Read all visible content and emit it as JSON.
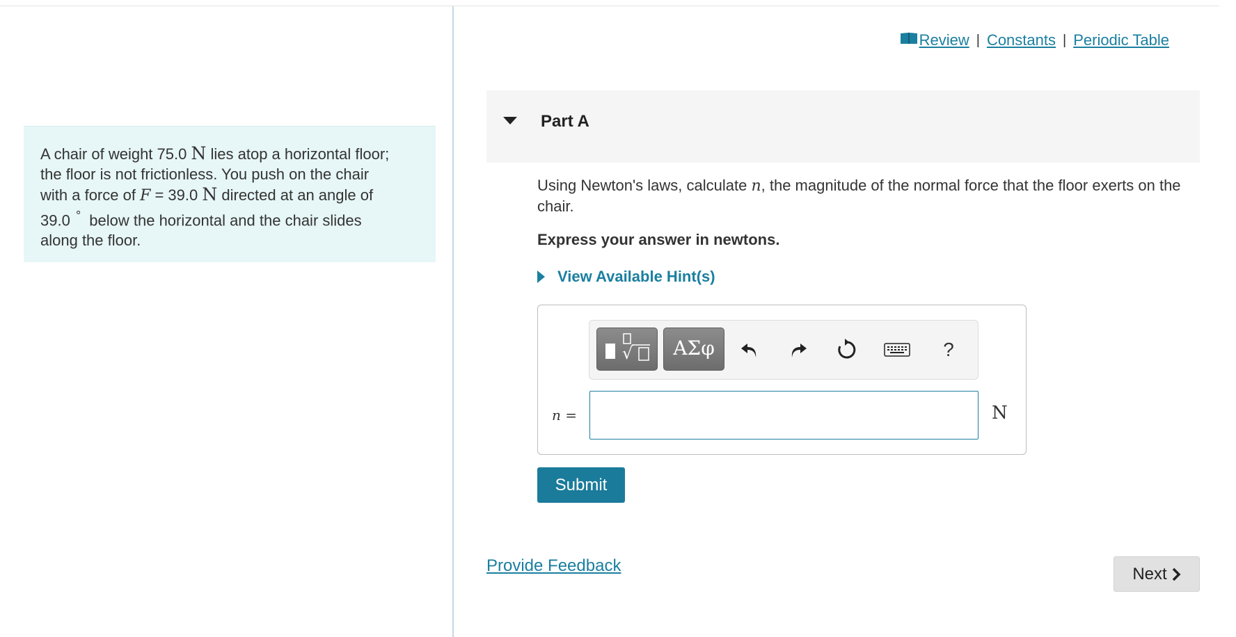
{
  "problem": {
    "line1_pre": "A chair of weight 75.0",
    "unit_N": "N",
    "line1_post": "lies atop a horizontal floor;",
    "line2": "the floor is not frictionless. You push on the chair",
    "line3_pre": "with a force of",
    "var_F": "F",
    "line3_eq": "= 39.0",
    "line3_post": "directed at an angle of",
    "line4_pre": "39.0",
    "degree": "°",
    "line4_post": "below the horizontal and the chair slides",
    "line5": "along the floor."
  },
  "top_links": {
    "review": "Review",
    "constants": "Constants",
    "periodic_table": "Periodic Table",
    "separator": "|"
  },
  "part": {
    "title": "Part A"
  },
  "question": {
    "pre": "Using Newton's laws, calculate",
    "var_n": "n",
    "post": ", the magnitude of the normal force that the floor exerts on the chair.",
    "express": "Express your answer in newtons.",
    "hints": "View Available Hint(s)"
  },
  "answer": {
    "label_var": "n",
    "label_eq": " =",
    "input_value": "",
    "unit": "N",
    "toolbar": {
      "greek_label": "ΑΣφ",
      "help_label": "?",
      "icons": [
        "template-icon",
        "greek-icon",
        "undo-icon",
        "redo-icon",
        "reset-icon",
        "keyboard-icon",
        "help-icon"
      ]
    }
  },
  "buttons": {
    "submit": "Submit",
    "next": "Next"
  },
  "feedback": "Provide Feedback",
  "colors": {
    "accent": "#1a7fa0",
    "submit_bg": "#1b7b9b",
    "problem_bg": "#e7f6f6",
    "part_header_bg": "#f5f5f5",
    "next_bg": "#e1e1e1"
  }
}
